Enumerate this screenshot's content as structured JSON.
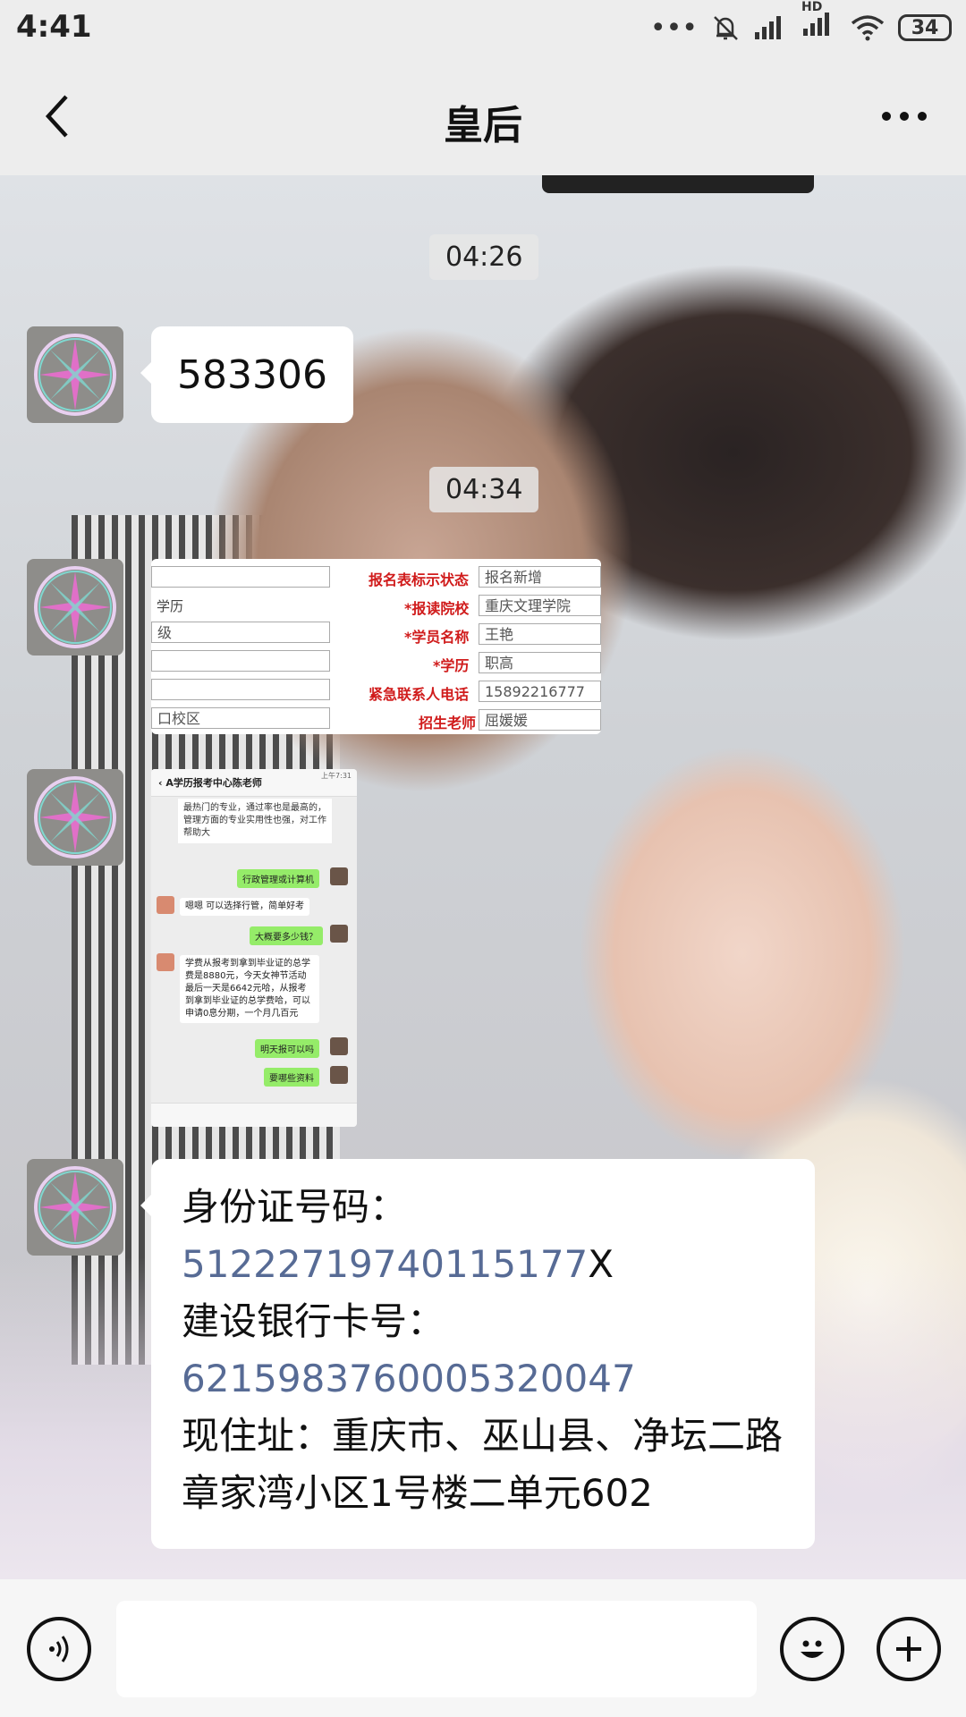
{
  "status_bar": {
    "time": "4:41",
    "battery": "34",
    "hd_label": "HD"
  },
  "header": {
    "title": "皇后"
  },
  "messages": {
    "time1": "04:26",
    "code": "583306",
    "time2": "04:34",
    "info": {
      "id_label": "身份证号码：",
      "id_number_link": "51222719740115177",
      "id_number_suffix": "X",
      "bank_label": "建设银行卡号：",
      "bank_number": "6215983760005320047",
      "address": "现住址：重庆市、巫山县、净坛二路章家湾小区1号楼二单元602"
    }
  },
  "form_image": {
    "left_col": [
      "学历",
      "级",
      "",
      "",
      "口校区"
    ],
    "labels": [
      "报名表标示状态",
      "*报读院校",
      "*学员名称",
      "*学历",
      "紧急联系人电话",
      "招生老师"
    ],
    "values": [
      "报名新增",
      "重庆文理学院",
      "王艳",
      "职高",
      "15892216777",
      "屈媛媛"
    ]
  },
  "phone_image": {
    "title": "A学历报考中心陈老师",
    "time": "上午7:31",
    "text1": "最热门的专业，通过率也是最高的，管理方面的专业实用性也强，对工作帮助大",
    "m1": "行政管理或计算机",
    "m2": "嗯嗯 可以选择行管，简单好考",
    "m3": "大概要多少钱？",
    "m4": "学费从报考到拿到毕业证的总学费是8880元，今天女神节活动最后一天是6642元哈，从报考到拿到毕业证的总学费哈，可以申请0息分期，一个月几百元",
    "m5": "明天报可以吗",
    "m6": "要哪些资料"
  },
  "icons": {
    "back": "chevron-left-icon",
    "more": "more-dots-icon",
    "voice": "voice-icon",
    "emoji": "emoji-icon",
    "plus": "plus-icon",
    "avatar": "compass-star-avatar"
  },
  "colors": {
    "link": "#576b95",
    "bar_bg": "#ededed",
    "bubble_bg": "#ffffff"
  }
}
